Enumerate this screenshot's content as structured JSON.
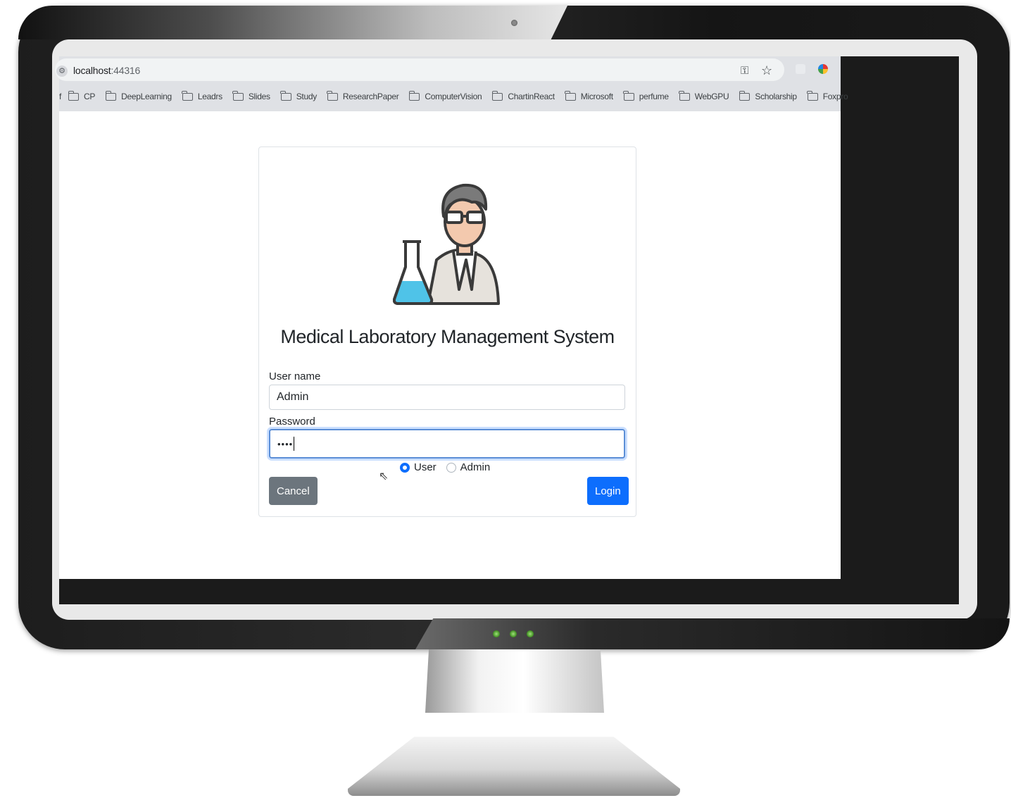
{
  "browser": {
    "url_host": "localhost",
    "url_port": ":44316",
    "bookmark_lead": "f",
    "bookmarks": [
      "CP",
      "DeepLearning",
      "Leadrs",
      "Slides",
      "Study",
      "ResearchPaper",
      "ComputerVision",
      "ChartinReact",
      "Microsoft",
      "perfume",
      "WebGPU",
      "Scholarship",
      "Foxpro"
    ]
  },
  "login": {
    "title": "Medical Laboratory Management System",
    "username_label": "User name",
    "username_value": "Admin",
    "password_label": "Password",
    "password_value": "••••",
    "role_options": [
      "User",
      "Admin"
    ],
    "role_selected": "User",
    "cancel_label": "Cancel",
    "login_label": "Login"
  },
  "icons": [
    "site-info-icon",
    "key-icon",
    "star-icon",
    "extension-icon",
    "color-picker-icon",
    "folder-icon",
    "scientist-logo-icon",
    "mouse-cursor-icon"
  ],
  "colors": {
    "primary": "#0d6efd",
    "secondary": "#6c757d",
    "flask_liquid": "#4fc3e8"
  }
}
